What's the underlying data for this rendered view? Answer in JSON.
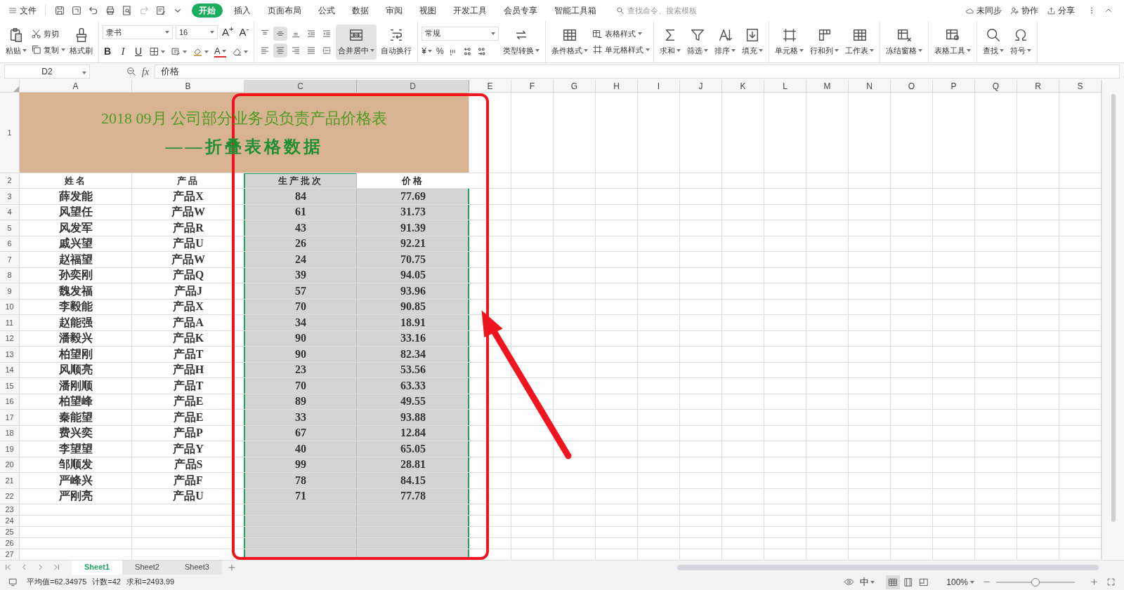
{
  "menu_bar": {
    "file": "文件",
    "tabs": [
      {
        "label": "开始",
        "selected": true
      },
      {
        "label": "插入",
        "selected": false
      },
      {
        "label": "页面布局",
        "selected": false
      },
      {
        "label": "公式",
        "selected": false
      },
      {
        "label": "数据",
        "selected": false
      },
      {
        "label": "审阅",
        "selected": false
      },
      {
        "label": "视图",
        "selected": false
      },
      {
        "label": "开发工具",
        "selected": false
      },
      {
        "label": "会员专享",
        "selected": false
      },
      {
        "label": "智能工具箱",
        "selected": false
      }
    ],
    "search": {
      "placeholder": "查找命令、搜索模板"
    },
    "actions": [
      "未同步",
      "协作",
      "分享"
    ]
  },
  "ribbon": {
    "groups": [
      {
        "items": [
          {
            "kind": "large",
            "label": "粘贴",
            "dropdown": true
          },
          {
            "kind": "small",
            "label": "剪切",
            "dropdown": false
          },
          {
            "kind": "small",
            "label": "复制",
            "dropdown": true
          },
          {
            "kind": "large",
            "label": "格式刷",
            "dropdown": false
          }
        ]
      },
      {
        "items": [
          {
            "kind": "font",
            "font_name": "隶书",
            "font_size": "16",
            "size_buttons": [
              "A$^{+}$",
              "A$^{-}$"
            ],
            "format_buttons": [
              "B",
              "I",
              "U"
            ],
            "font_color_label": "A"
          }
        ]
      },
      {
        "items": [
          {
            "kind": "align",
            "buttons": [
              {
                "selected": false
              },
              {
                "selected": true
              },
              {
                "selected": false
              },
              {
                "selected": false
              },
              {
                "selected": false
              },
              {
                "selected": false
              },
              {
                "selected": true
              },
              {
                "selected": false
              },
              {
                "selected": false
              },
              {
                "selected": false
              }
            ]
          },
          {
            "kind": "large",
            "label": "合并居中",
            "dropdown": true,
            "selected": true
          },
          {
            "kind": "large",
            "label": "自动换行",
            "dropdown": false,
            "selected": false
          }
        ]
      },
      {
        "items": [
          {
            "kind": "number",
            "format": "常规",
            "symbols": [
              "¥",
              "%"
            ]
          },
          {
            "kind": "large",
            "label": "类型转换",
            "dropdown": true
          }
        ]
      },
      {
        "items": [
          {
            "kind": "large",
            "label": "条件格式",
            "dropdown": true
          },
          {
            "kind": "small",
            "label": "表格样式",
            "dropdown": true
          },
          {
            "kind": "small",
            "label": "单元格样式",
            "dropdown": true
          }
        ]
      },
      {
        "items": [
          {
            "kind": "large",
            "label": "求和",
            "dropdown": true
          },
          {
            "kind": "large",
            "label": "筛选",
            "dropdown": true
          },
          {
            "kind": "large",
            "label": "排序",
            "dropdown": true
          },
          {
            "kind": "large",
            "label": "填充",
            "dropdown": true
          }
        ]
      },
      {
        "items": [
          {
            "kind": "large",
            "label": "单元格",
            "dropdown": true
          },
          {
            "kind": "large",
            "label": "行和列",
            "dropdown": true
          },
          {
            "kind": "large",
            "label": "工作表",
            "dropdown": true
          }
        ]
      },
      {
        "items": [
          {
            "kind": "large",
            "label": "冻结窗格",
            "dropdown": true
          }
        ]
      },
      {
        "items": [
          {
            "kind": "large",
            "label": "表格工具",
            "dropdown": true
          }
        ]
      },
      {
        "items": [
          {
            "kind": "large",
            "label": "查找",
            "dropdown": true
          },
          {
            "kind": "large",
            "label": "符号",
            "dropdown": true
          }
        ]
      }
    ]
  },
  "formula_bar": {
    "name_box": "D2",
    "fx": "fx",
    "value": "价格"
  },
  "sheet": {
    "columns": [
      {
        "label": "A",
        "selected": false
      },
      {
        "label": "B",
        "selected": false
      },
      {
        "label": "C",
        "selected": true
      },
      {
        "label": "D",
        "selected": true
      },
      {
        "label": "E",
        "selected": false
      },
      {
        "label": "F",
        "selected": false
      },
      {
        "label": "G",
        "selected": false
      },
      {
        "label": "H",
        "selected": false
      },
      {
        "label": "I",
        "selected": false
      },
      {
        "label": "J",
        "selected": false
      },
      {
        "label": "K",
        "selected": false
      },
      {
        "label": "L",
        "selected": false
      },
      {
        "label": "M",
        "selected": false
      },
      {
        "label": "N",
        "selected": false
      },
      {
        "label": "O",
        "selected": false
      },
      {
        "label": "P",
        "selected": false
      },
      {
        "label": "Q",
        "selected": false
      },
      {
        "label": "R",
        "selected": false
      },
      {
        "label": "S",
        "selected": false
      }
    ],
    "title_row": {
      "number": "1",
      "lines": [
        "2018 09月 公司部分业务员负责产品价格表",
        "——折叠表格数据"
      ]
    },
    "header_row": {
      "number": "2",
      "cells": [
        {
          "text": "姓名",
          "active": false
        },
        {
          "text": "产品",
          "active": false
        },
        {
          "text": "生产批次",
          "active": false
        },
        {
          "text": "价格",
          "active": true
        }
      ]
    },
    "rows": [
      {
        "number": "3",
        "cells": [
          "薛发能",
          "产品X",
          "84",
          "77.69"
        ]
      },
      {
        "number": "4",
        "cells": [
          "风望任",
          "产品W",
          "61",
          "31.73"
        ]
      },
      {
        "number": "5",
        "cells": [
          "风发军",
          "产品R",
          "43",
          "91.39"
        ]
      },
      {
        "number": "6",
        "cells": [
          "戚兴望",
          "产品U",
          "26",
          "92.21"
        ]
      },
      {
        "number": "7",
        "cells": [
          "赵福望",
          "产品W",
          "24",
          "70.75"
        ]
      },
      {
        "number": "8",
        "cells": [
          "孙奕刚",
          "产品Q",
          "39",
          "94.05"
        ]
      },
      {
        "number": "9",
        "cells": [
          "魏发福",
          "产品J",
          "57",
          "93.96"
        ]
      },
      {
        "number": "10",
        "cells": [
          "李毅能",
          "产品X",
          "70",
          "90.85"
        ]
      },
      {
        "number": "11",
        "cells": [
          "赵能强",
          "产品A",
          "34",
          "18.91"
        ]
      },
      {
        "number": "12",
        "cells": [
          "潘毅兴",
          "产品K",
          "90",
          "33.16"
        ]
      },
      {
        "number": "13",
        "cells": [
          "柏望刚",
          "产品T",
          "90",
          "82.34"
        ]
      },
      {
        "number": "14",
        "cells": [
          "风顺亮",
          "产品H",
          "23",
          "53.56"
        ]
      },
      {
        "number": "15",
        "cells": [
          "潘刚顺",
          "产品T",
          "70",
          "63.33"
        ]
      },
      {
        "number": "16",
        "cells": [
          "柏望峰",
          "产品E",
          "89",
          "49.55"
        ]
      },
      {
        "number": "17",
        "cells": [
          "秦能望",
          "产品E",
          "33",
          "93.88"
        ]
      },
      {
        "number": "18",
        "cells": [
          "费兴奕",
          "产品P",
          "67",
          "12.84"
        ]
      },
      {
        "number": "19",
        "cells": [
          "李望望",
          "产品Y",
          "40",
          "65.05"
        ]
      },
      {
        "number": "20",
        "cells": [
          "邹顺发",
          "产品S",
          "99",
          "28.81"
        ]
      },
      {
        "number": "21",
        "cells": [
          "严峰兴",
          "产品F",
          "78",
          "84.15"
        ]
      },
      {
        "number": "22",
        "cells": [
          "严刚亮",
          "产品U",
          "71",
          "77.78"
        ]
      }
    ],
    "empty_rows": [
      "23",
      "24",
      "25",
      "26",
      "27"
    ]
  },
  "sheet_tabs": [
    {
      "label": "Sheet1",
      "selected": true
    },
    {
      "label": "Sheet2",
      "selected": false
    },
    {
      "label": "Sheet3",
      "selected": false
    }
  ],
  "status_bar": {
    "stats": [
      "平均值=62.34975",
      "计数=42",
      "求和=2493.99"
    ],
    "input_mode": "中",
    "views": [
      {
        "selected": true
      },
      {
        "selected": false
      },
      {
        "selected": false
      }
    ],
    "zoom": "100%",
    "zoom_slider": {
      "level": 0.5
    }
  }
}
